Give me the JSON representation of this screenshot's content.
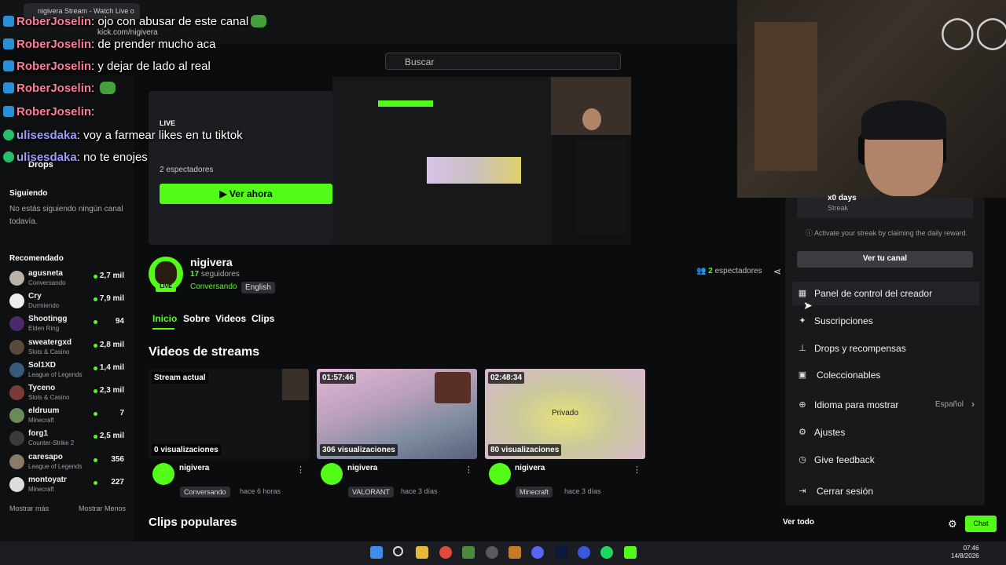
{
  "browser": {
    "tab_title": "nigivera Stream - Watch Live o",
    "url": "kick.com/nigivera"
  },
  "header": {
    "search_placeholder": "Buscar"
  },
  "sidebar": {
    "nav_drops": "Drops",
    "following_title": "Siguiendo",
    "following_empty": "No estás siguiendo ningún canal todavía.",
    "recommended_title": "Recomendado",
    "channels": [
      {
        "name": "agusneta",
        "category": "Conversando",
        "viewers": "2,7 mil"
      },
      {
        "name": "Cry",
        "category": "Durmiendo",
        "viewers": "7,9 mil"
      },
      {
        "name": "Shootingg",
        "category": "Elden Ring",
        "viewers": "94"
      },
      {
        "name": "sweatergxd",
        "category": "Slots & Casino",
        "viewers": "2,8 mil"
      },
      {
        "name": "Sol1XD",
        "category": "League of Legends",
        "viewers": "1,4 mil"
      },
      {
        "name": "Tyceno",
        "category": "Slots & Casino",
        "viewers": "2,3 mil"
      },
      {
        "name": "eldruum",
        "category": "Minecraft",
        "viewers": "7"
      },
      {
        "name": "forg1",
        "category": "Counter-Strike 2",
        "viewers": "2,5 mil"
      },
      {
        "name": "caresapo",
        "category": "League of Legends",
        "viewers": "356"
      },
      {
        "name": "montoyatr",
        "category": "Minecraft",
        "viewers": "227"
      }
    ],
    "show_more": "Mostrar más",
    "show_less": "Mostrar Menos"
  },
  "hero": {
    "live_label": "LIVE",
    "viewers": "2 espectadores",
    "watch_button": "Ver ahora"
  },
  "channel": {
    "name": "nigivera",
    "followers_count": "17",
    "followers_label": "seguidores",
    "category": "Conversando",
    "language": "English",
    "live_badge": "LIVE",
    "viewers_count": "2",
    "viewers_label": "espectadores",
    "tabs": [
      "Inicio",
      "Sobre",
      "Videos",
      "Clips"
    ]
  },
  "videos": {
    "title": "Videos de streams",
    "items": [
      {
        "badge": "Stream actual",
        "views": "0 visualizaciones",
        "channel": "nigivera",
        "category": "Conversando",
        "time": "hace 6 horas"
      },
      {
        "badge": "01:57:46",
        "views": "306 visualizaciones",
        "channel": "nigivera",
        "category": "VALORANT",
        "time": "hace 3 días"
      },
      {
        "badge": "02:48:34",
        "views": "80 visualizaciones",
        "channel": "nigivera",
        "category": "Minecraft",
        "time": "hace 3 días",
        "overlay": "Privado"
      }
    ]
  },
  "clips": {
    "title": "Clips populares",
    "see_all": "Ver todo"
  },
  "chat_button": "Chat",
  "menu": {
    "streak_days": "x0 days",
    "streak_label": "Streak",
    "streak_info": "Activate your streak by claiming the daily reward.",
    "view_channel": "Ver tu canal",
    "items": {
      "creator_panel": "Panel de control del creador",
      "subscriptions": "Suscripciones",
      "drops": "Drops y recompensas",
      "collectibles": "Coleccionables",
      "language": "Idioma para mostrar",
      "language_value": "Español",
      "settings": "Ajustes",
      "feedback": "Give feedback",
      "logout": "Cerrar sesión"
    }
  },
  "chat_overlay": [
    {
      "user": "RoberJoselin",
      "text": "ojo con abusar de este canal",
      "color": "pink"
    },
    {
      "user": "RoberJoselin",
      "text": "de prender mucho aca",
      "color": "pink"
    },
    {
      "user": "RoberJoselin",
      "text": "y dejar de lado al real",
      "color": "pink"
    },
    {
      "user": "RoberJoselin",
      "text": "",
      "color": "pink"
    },
    {
      "user": "RoberJoselin",
      "text": "",
      "color": "pink"
    },
    {
      "user": "ulisesdaka",
      "text": "voy a farmear likes en tu tiktok",
      "color": "purple"
    },
    {
      "user": "ulisesdaka",
      "text": "no te enojes",
      "color": "purple"
    }
  ],
  "taskbar": {
    "time": "07:46",
    "date": "14/8/2026"
  },
  "colors": {
    "accent": "#53fc18",
    "background": "#0b0c0d"
  }
}
